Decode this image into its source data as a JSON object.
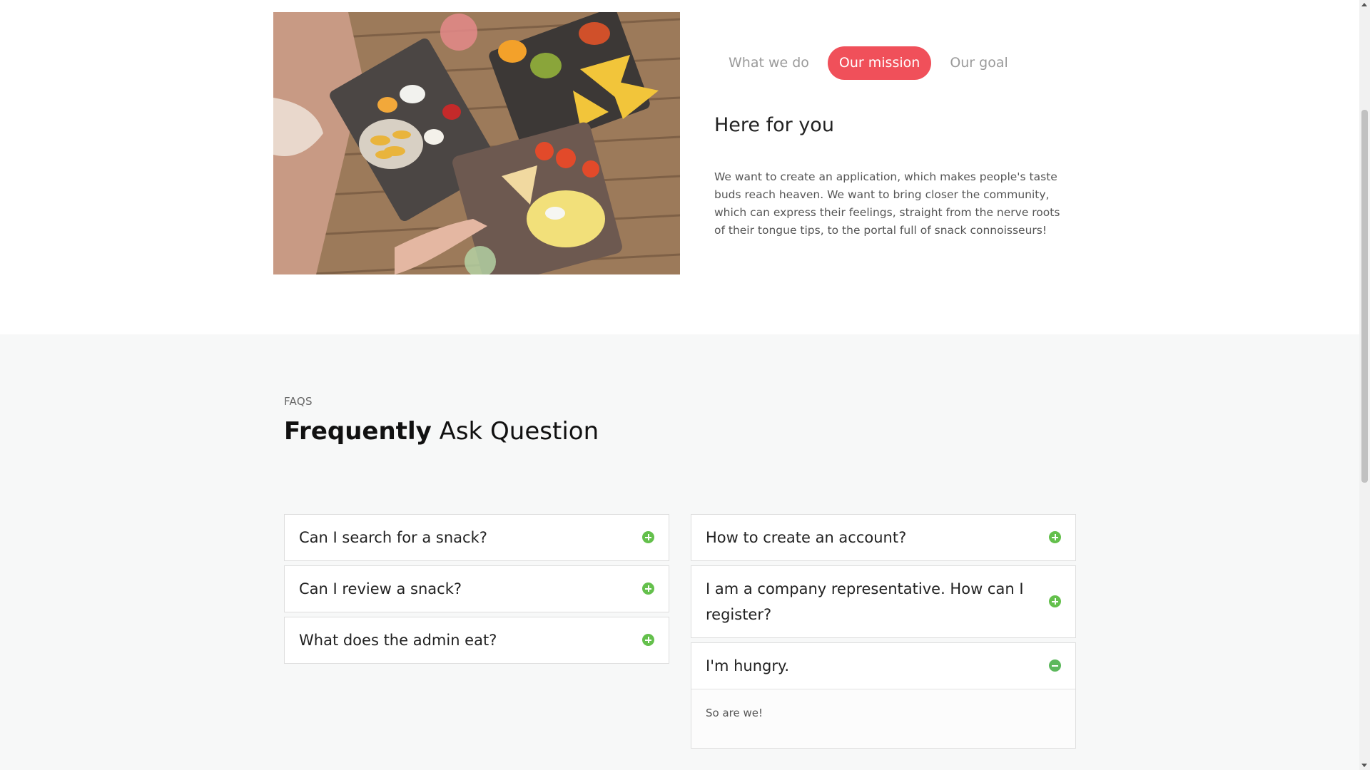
{
  "about": {
    "tabs": [
      {
        "label": "What we do",
        "active": false
      },
      {
        "label": "Our mission",
        "active": true
      },
      {
        "label": "Our goal",
        "active": false
      }
    ],
    "title": "Here for you",
    "text": "We want to create an application, which makes people's taste buds reach heaven. We want to bring closer the community, which can express their feelings, straight from the nerve roots of their tongue tips, to the portal full of snack connoisseurs!"
  },
  "faq": {
    "eyebrow": "FAQS",
    "title_bold": "Frequently",
    "title_rest": "Ask Question",
    "left": [
      {
        "question": "Can I search for a snack?",
        "icon": "plus-circle-icon"
      },
      {
        "question": "Can I review a snack?",
        "icon": "plus-circle-icon"
      },
      {
        "question": "What does the admin eat?",
        "icon": "plus-circle-icon"
      }
    ],
    "right": [
      {
        "question": "How to create an account?",
        "icon": "plus-circle-icon"
      },
      {
        "question": "I am a company representative. How can I register?",
        "icon": "plus-circle-icon"
      },
      {
        "question": "I'm hungry.",
        "icon": "minus-circle-icon",
        "answer": "So are we!"
      }
    ]
  },
  "colors": {
    "accent": "#f0505a",
    "icon_green": "#64c04c",
    "section_bg": "#f7f8f8"
  }
}
